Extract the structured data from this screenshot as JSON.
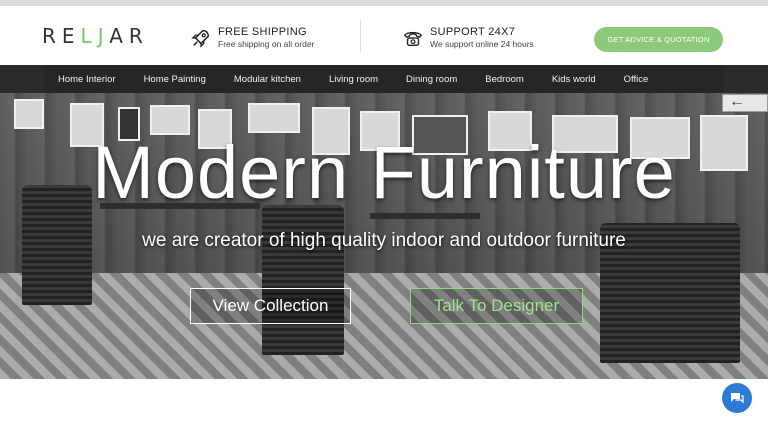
{
  "logo": {
    "text_a": "RE",
    "text_b": "L",
    "text_c": "J",
    "text_d": "AR"
  },
  "features": [
    {
      "icon": "rocket-icon",
      "title": "FREE SHIPPING",
      "subtitle": "Free shipping on all order"
    },
    {
      "icon": "phone-icon",
      "title": "SUPPORT 24X7",
      "subtitle": "We support online 24 hours"
    }
  ],
  "cta_label": "GET ADVICE & QUOTATION",
  "nav": [
    "Home Interior",
    "Home Painting",
    "Modular kitchen",
    "Living room",
    "Dining room",
    "Bedroom",
    "Kids world",
    "Office"
  ],
  "hero": {
    "title": "Modern Furniture",
    "subtitle": "we are creator of high quality indoor and outdoor furniture",
    "button_primary": "View Collection",
    "button_secondary": "Talk To Designer"
  },
  "colors": {
    "accent": "#8cc97a",
    "nav_bg": "#262626",
    "chat": "#2e7bd6"
  }
}
